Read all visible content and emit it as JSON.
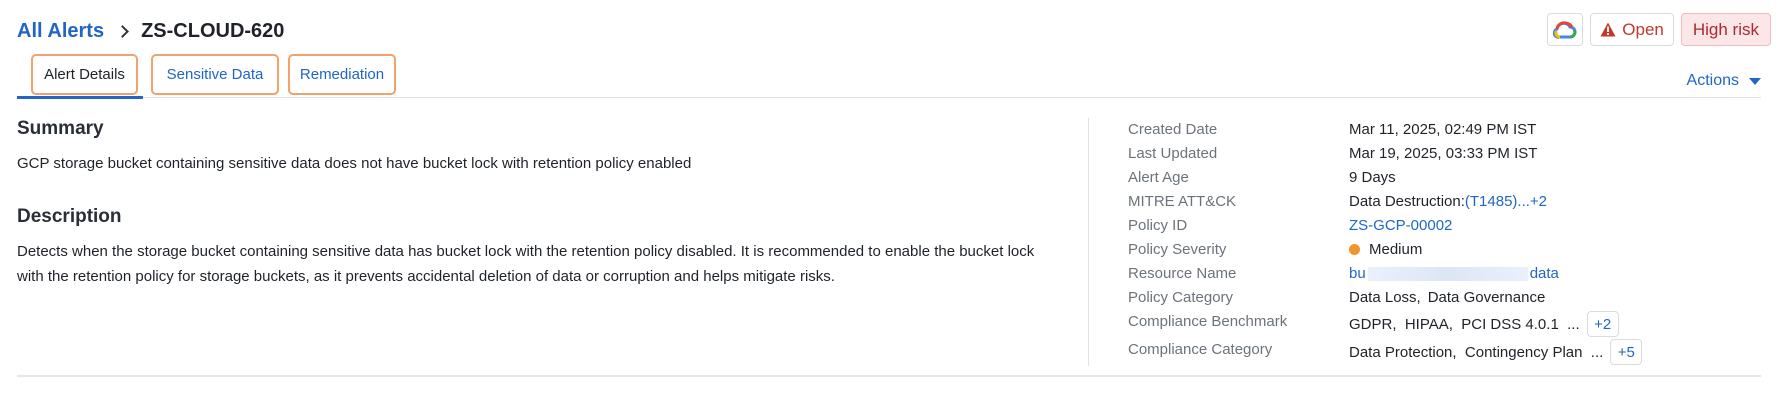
{
  "breadcrumb": {
    "parent": "All Alerts",
    "current": "ZS-CLOUD-620"
  },
  "header": {
    "open_label": "Open",
    "risk_label": "High risk"
  },
  "tabs": [
    {
      "label": "Alert Details"
    },
    {
      "label": "Sensitive Data"
    },
    {
      "label": "Remediation"
    }
  ],
  "actions_label": "Actions",
  "summary": {
    "title": "Summary",
    "text": "GCP storage bucket containing sensitive data does not have bucket lock with retention policy enabled"
  },
  "description": {
    "title": "Description",
    "text": "Detects when the storage bucket containing sensitive data has bucket lock with the retention policy disabled. It is recommended to enable the bucket lock with the retention policy for storage buckets, as it prevents accidental deletion of data or corruption and helps mitigate risks."
  },
  "details": {
    "created_label": "Created Date",
    "created_value": "Mar 11, 2025, 02:49 PM IST",
    "updated_label": "Last Updated",
    "updated_value": "Mar 19, 2025, 03:33 PM IST",
    "age_label": "Alert Age",
    "age_value": "9 Days",
    "mitre_label": "MITRE ATT&CK",
    "mitre_prefix": "Data Destruction:",
    "mitre_link": "(T1485)",
    "mitre_more": "...+2",
    "policy_id_label": "Policy ID",
    "policy_id_value": "ZS-GCP-00002",
    "severity_label": "Policy Severity",
    "severity_value": "Medium",
    "severity_color": "#f0962c",
    "resource_label": "Resource Name",
    "resource_start": "bu",
    "resource_end": "data",
    "category_label": "Policy Category",
    "category_value_1": "Data Loss,",
    "category_value_2": "Data Governance",
    "benchmark_label": "Compliance Benchmark",
    "benchmark_value": "GDPR,  HIPAA,  PCI DSS 4.0.1  ...",
    "benchmark_more": "+2",
    "comp_cat_label": "Compliance Category",
    "comp_cat_value": "Data Protection,  Contingency Plan  ...",
    "comp_cat_more": "+5"
  },
  "colors": {
    "accent": "#2166c7",
    "risk_bg": "#fbe7e8",
    "risk_text": "#b32635",
    "tab_highlight": "#f2a36b"
  }
}
